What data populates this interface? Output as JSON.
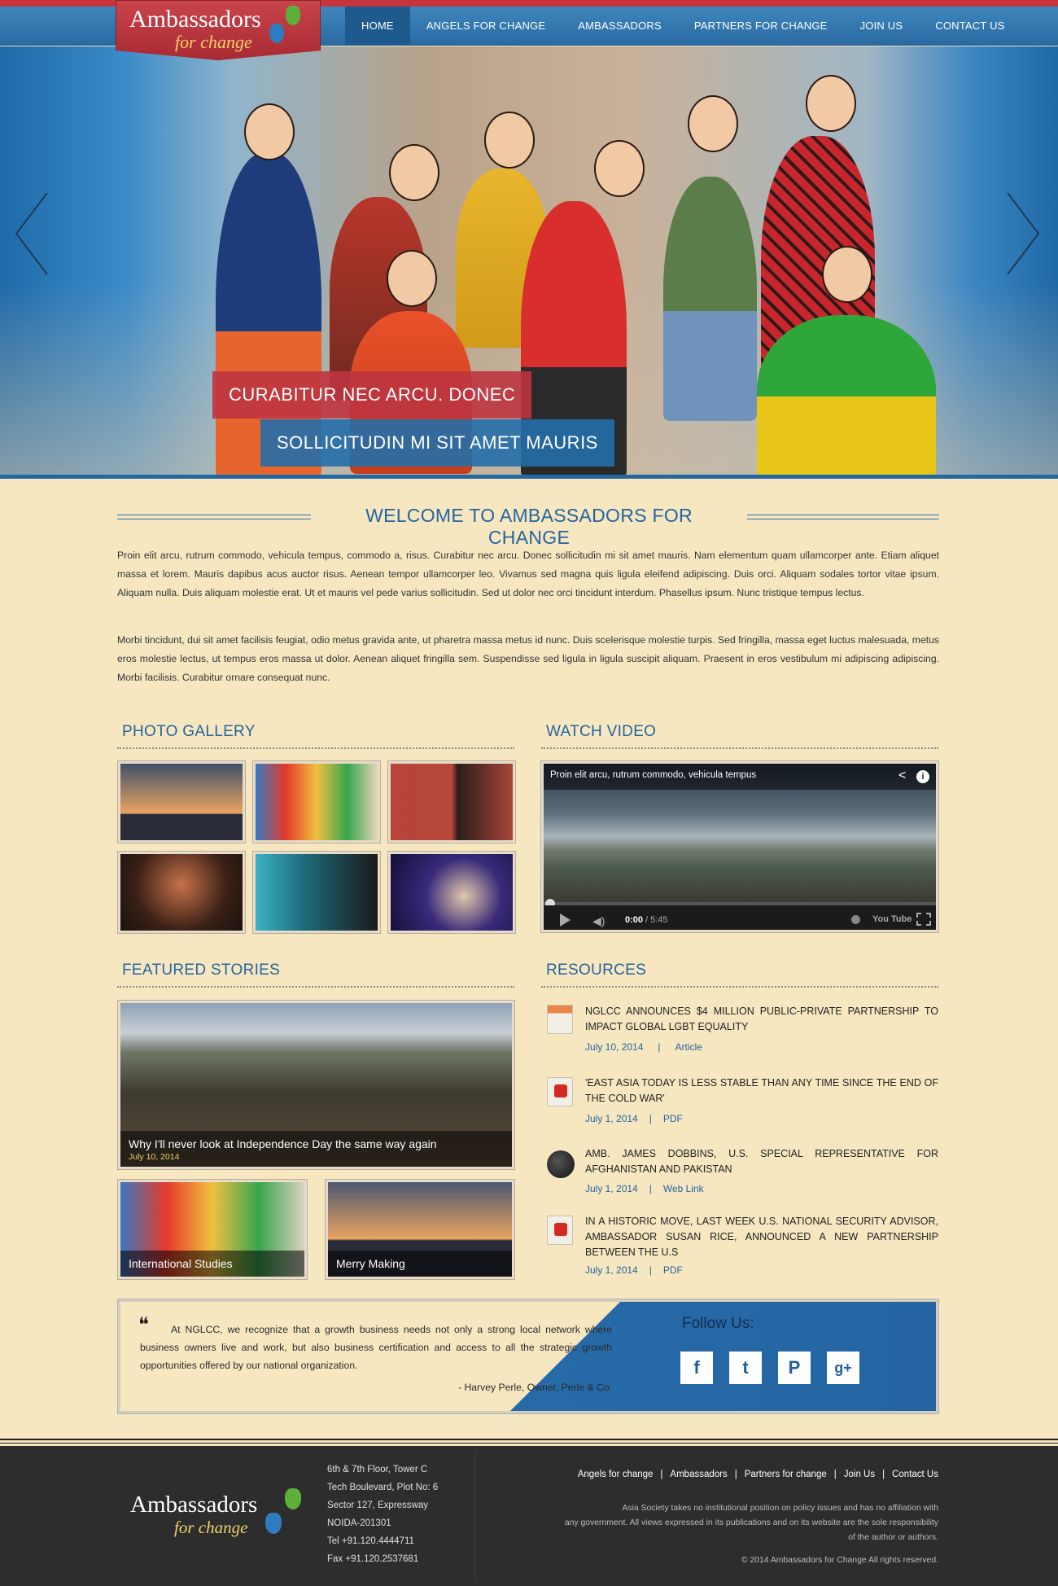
{
  "logo": {
    "main": "Ambassadors",
    "sub": "for change"
  },
  "nav": {
    "items": [
      "HOME",
      "ANGELS FOR CHANGE",
      "AMBASSADORS",
      "PARTNERS FOR CHANGE",
      "JOIN US",
      "CONTACT US"
    ],
    "active_index": 0
  },
  "hero": {
    "caption_line1": "CURABITUR NEC ARCU. DONEC",
    "caption_line2": "SOLLICITUDIN MI SIT AMET MAURIS"
  },
  "welcome": {
    "title": "WELCOME TO AMBASSADORS FOR CHANGE",
    "para1": "Proin elit arcu, rutrum commodo, vehicula tempus, commodo a, risus. Curabitur nec arcu. Donec sollicitudin mi sit amet mauris. Nam elementum quam ullamcorper ante. Etiam aliquet massa et lorem. Mauris dapibus acus auctor risus. Aenean tempor ullamcorper leo. Vivamus sed magna quis ligula eleifend adipiscing. Duis orci. Aliquam sodales tortor vitae ipsum. Aliquam nulla. Duis aliquam molestie erat. Ut et mauris vel pede varius sollicitudin. Sed ut dolor nec orci tincidunt interdum. Phasellus ipsum. Nunc tristique tempus lectus.",
    "para2": "Morbi tincidunt, dui sit amet facilisis feugiat, odio metus gravida ante, ut pharetra massa metus id nunc. Duis scelerisque molestie turpis. Sed fringilla, massa eget luctus malesuada, metus eros molestie lectus, ut tempus eros massa ut dolor. Aenean aliquet fringilla sem. Suspendisse sed ligula in ligula suscipit aliquam. Praesent in eros vestibulum mi adipiscing adipiscing. Morbi facilisis. Curabitur ornare consequat nunc."
  },
  "gallery": {
    "title": "PHOTO GALLERY"
  },
  "video": {
    "title": "WATCH VIDEO",
    "caption": "Proin elit arcu, rutrum commodo, vehicula tempus",
    "time_current": "0:00",
    "time_total": "/ 5:45",
    "youtube": "You Tube"
  },
  "featured": {
    "title": "FEATURED STORIES",
    "main_caption": "Why I'll never look at Independence Day the same way again",
    "main_date": "July 10, 2014",
    "small1": "International Studies",
    "small2": "Merry Making"
  },
  "resources": {
    "title": "RESOURCES",
    "items": [
      {
        "title": "NGLCC ANNOUNCES $4 MILLION PUBLIC-PRIVATE PARTNERSHIP TO IMPACT GLOBAL LGBT EQUALITY",
        "date": "July 10, 2014",
        "sep": "|",
        "type": "Article",
        "icon": "calendar-icon"
      },
      {
        "title": "'EAST ASIA TODAY IS LESS STABLE THAN ANY TIME SINCE THE END OF THE COLD WAR'",
        "date": "July 1, 2014",
        "sep": "|",
        "type": "PDF",
        "icon": "pdf-icon"
      },
      {
        "title": "AMB. JAMES DOBBINS, U.S. SPECIAL REPRESENTATIVE FOR AFGHANISTAN AND PAKISTAN",
        "date": "July 1, 2014",
        "sep": "|",
        "type": "Web Link",
        "icon": "globe-icon"
      },
      {
        "title": "IN A HISTORIC MOVE, LAST WEEK U.S. NATIONAL SECURITY ADVISOR, AMBASSADOR SUSAN RICE, ANNOUNCED A NEW PARTNERSHIP BETWEEN THE U.S",
        "date": "July 1, 2014",
        "sep": "|",
        "type": "PDF",
        "icon": "pdf-icon"
      }
    ]
  },
  "quote": {
    "mark": "❝",
    "text": "At NGLCC, we recognize that a growth business needs not only a strong local network where business owners live and work, but also business certification and access to all the strategic growth opportunities offered by our national organization.",
    "author": "- Harvey Perle, Owner, Perle & Co.",
    "follow": "Follow Us:",
    "social": [
      "f",
      "t",
      "P",
      "g+"
    ]
  },
  "footer": {
    "address": [
      "6th & 7th Floor, Tower C",
      "Tech Boulevard, Plot No: 6",
      "Sector 127, Expressway",
      "NOIDA-201301",
      "Tel +91.120.4444711",
      "Fax +91.120.2537681"
    ],
    "links": [
      "Angels for change",
      "Ambassadors",
      "Partners for change",
      "Join Us",
      "Contact Us"
    ],
    "link_sep": "|",
    "disclaimer1": "Asia Society takes no institutional position on policy issues and has no affiliation with",
    "disclaimer2": "any government.  All views expressed in its publications and on its website are the sole responsibility",
    "disclaimer3": "of the author or authors.",
    "copyright": "© 2014 Ambassadors for Change All rights reserved."
  },
  "colors": {
    "accent_blue": "#2464a0",
    "brand_red": "#c8343c",
    "background": "#f6e7c1",
    "footer": "#2d2d2d"
  }
}
